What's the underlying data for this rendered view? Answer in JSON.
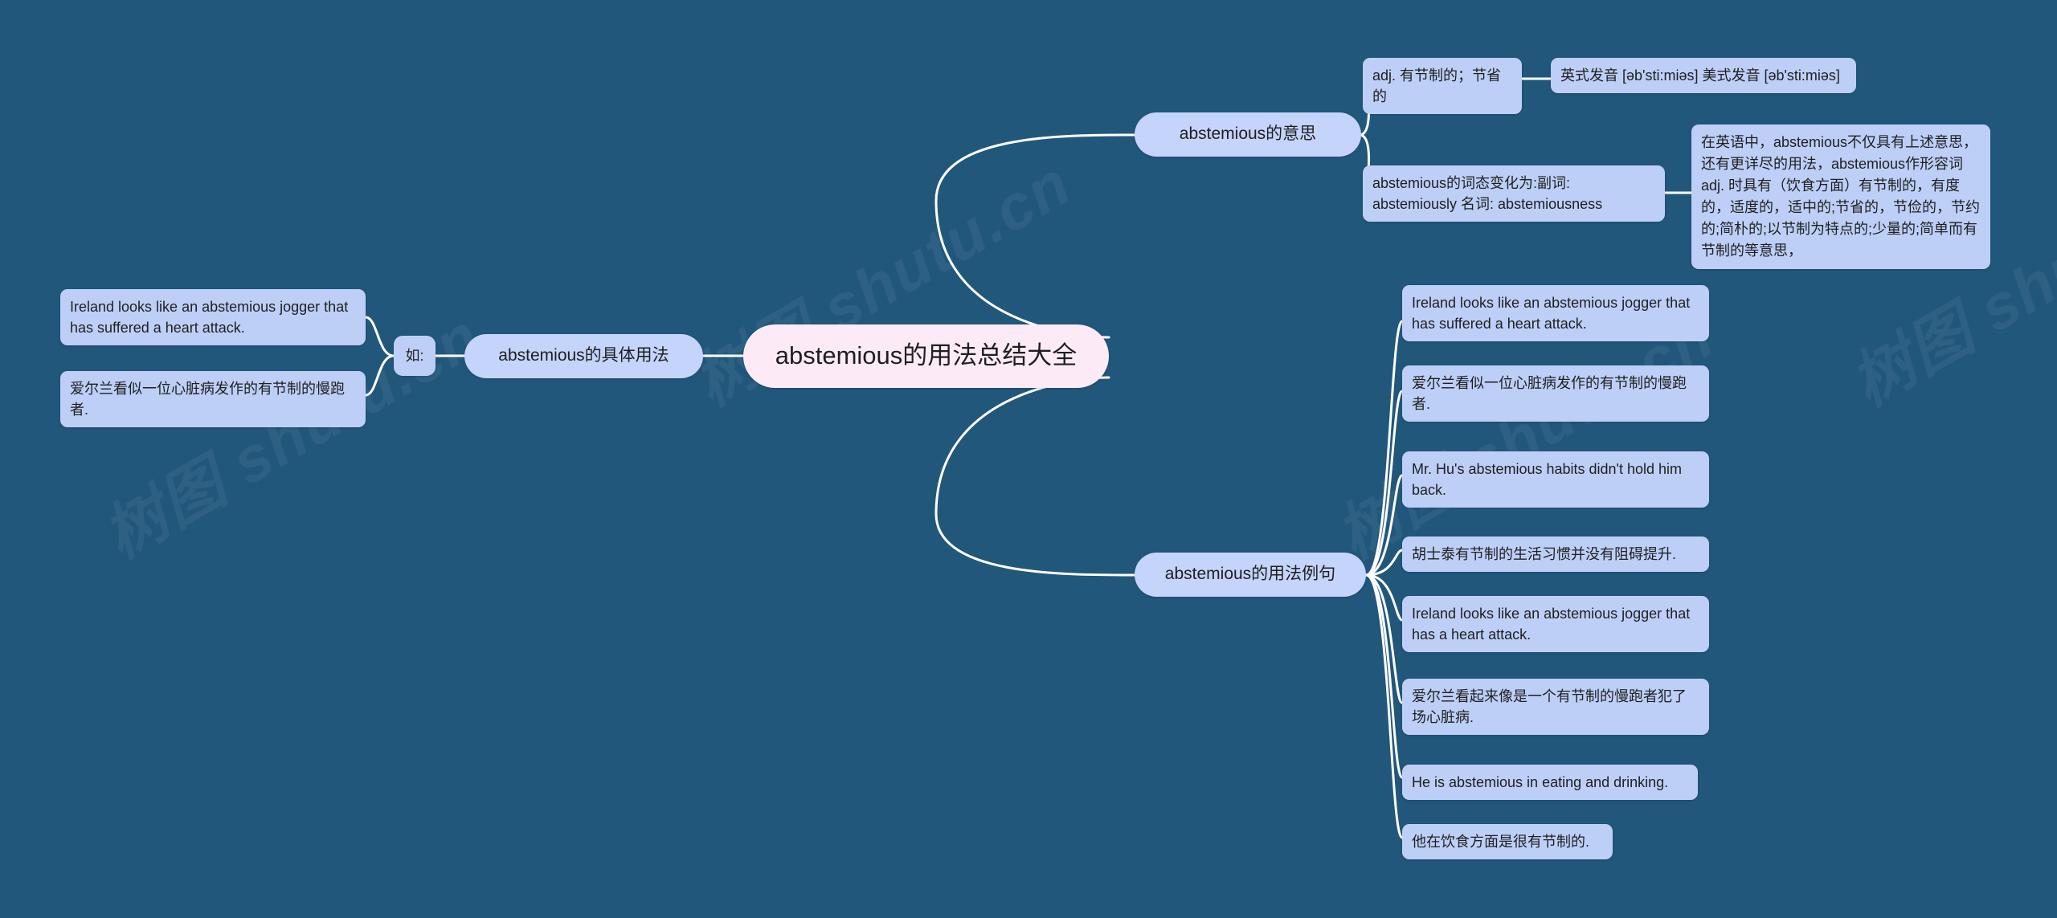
{
  "theme": {
    "background": "#22577c",
    "root_fill": "#fcebf7",
    "branch_fill": "#c5d4fb",
    "leaf_fill": "#bdcff7",
    "link_stroke": "#ffffff",
    "text_color": "#1f1f1f"
  },
  "watermark": {
    "text": "树图 shutu.cn"
  },
  "root": {
    "label": "abstemious的用法总结大全"
  },
  "branches": {
    "meaning": {
      "label": "abstemious的意思",
      "children": [
        {
          "label": "adj. 有节制的；节省的",
          "children": [
            {
              "label": "英式发音 [əb'sti:miəs] 美式发音 [əb'sti:miəs]"
            }
          ]
        },
        {
          "label": "abstemious的词态变化为:副词: abstemiously 名词: abstemiousness",
          "children": [
            {
              "label": "在英语中，abstemious不仅具有上述意思，还有更详尽的用法，abstemious作形容词 adj. 时具有（饮食方面）有节制的，有度的，适度的，适中的;节省的，节俭的，节约的;简朴的;以节制为特点的;少量的;简单而有节制的等意思，"
            }
          ]
        }
      ]
    },
    "usage": {
      "label": "abstemious的具体用法",
      "connector": "如:",
      "children": [
        {
          "label": "Ireland looks like an abstemious jogger that has suffered a heart attack."
        },
        {
          "label": "爱尔兰看似一位心脏病发作的有节制的慢跑者."
        }
      ]
    },
    "examples": {
      "label": "abstemious的用法例句",
      "children": [
        {
          "label": "Ireland looks like an abstemious jogger that has suffered a heart attack."
        },
        {
          "label": "爱尔兰看似一位心脏病发作的有节制的慢跑者."
        },
        {
          "label": "Mr. Hu's abstemious habits didn't hold him back."
        },
        {
          "label": "胡士泰有节制的生活习惯并没有阻碍提升."
        },
        {
          "label": "Ireland looks like an abstemious jogger that has a heart attack."
        },
        {
          "label": "爱尔兰看起来像是一个有节制的慢跑者犯了场心脏病."
        },
        {
          "label": "He is abstemious in eating and drinking."
        },
        {
          "label": "他在饮食方面是很有节制的."
        }
      ]
    }
  }
}
